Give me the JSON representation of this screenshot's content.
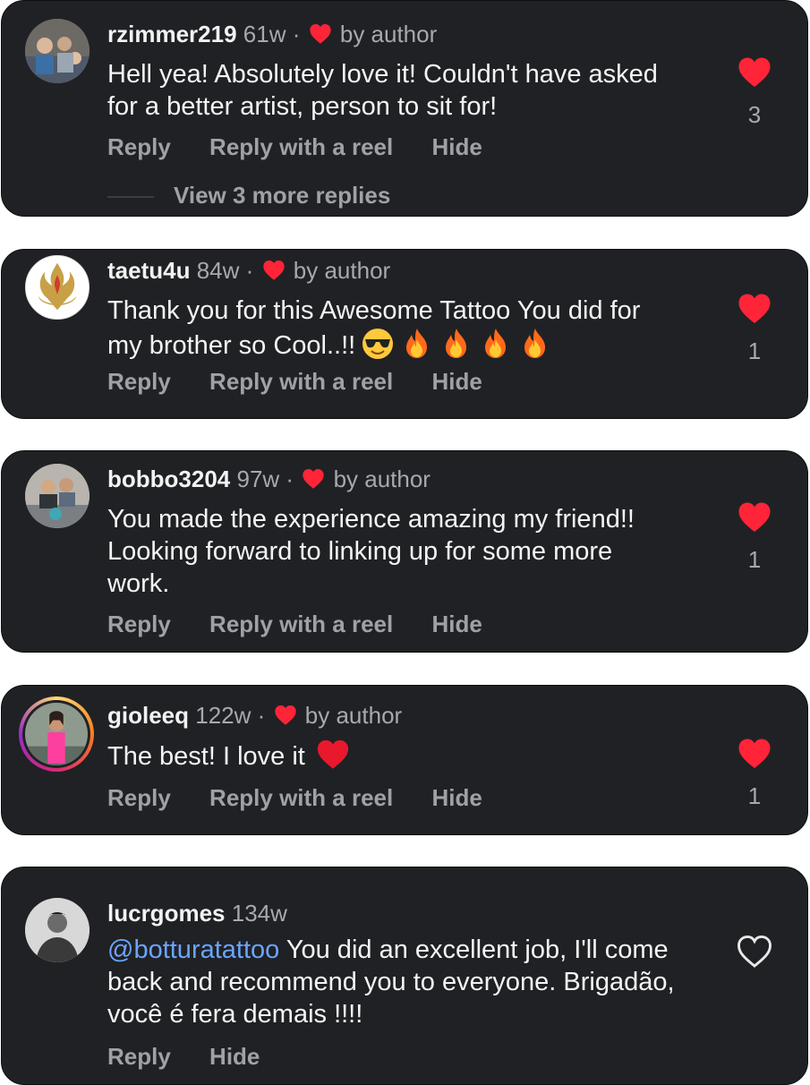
{
  "colors": {
    "card_bg": "#202124",
    "heart_red": "#ff2438",
    "mention_blue": "#6aa5ff",
    "muted_text": "#a8a9ad"
  },
  "comments": [
    {
      "username": "rzimmer219",
      "age": "61w",
      "separator": "·",
      "author_badge": "by author",
      "text": "Hell yea! Absolutely love it! Couldn't have asked for a better artist, person to sit for!",
      "likes": "3",
      "liked": true,
      "actions": {
        "reply": "Reply",
        "reply_reel": "Reply with a reel",
        "hide": "Hide"
      },
      "view_more": "View 3 more replies"
    },
    {
      "username": "taetu4u",
      "age": "84w",
      "separator": "·",
      "author_badge": "by author",
      "text": "Thank you for this Awesome Tattoo You did for my brother so Cool..!!",
      "emojis": [
        "sunglasses-emoji",
        "fire-emoji",
        "fire-emoji",
        "fire-emoji",
        "fire-emoji"
      ],
      "likes": "1",
      "liked": true,
      "actions": {
        "reply": "Reply",
        "reply_reel": "Reply with a reel",
        "hide": "Hide"
      }
    },
    {
      "username": "bobbo3204",
      "age": "97w",
      "separator": "·",
      "author_badge": "by author",
      "text": "You made the experience amazing my friend!! Looking forward to linking up for some more work.",
      "likes": "1",
      "liked": true,
      "actions": {
        "reply": "Reply",
        "reply_reel": "Reply with a reel",
        "hide": "Hide"
      }
    },
    {
      "username": "gioleeq",
      "age": "122w",
      "separator": "·",
      "author_badge": "by author",
      "text": "The best! I love it",
      "emojis": [
        "red-heart-emoji"
      ],
      "likes": "1",
      "liked": true,
      "actions": {
        "reply": "Reply",
        "reply_reel": "Reply with a reel",
        "hide": "Hide"
      }
    },
    {
      "username": "lucrgomes",
      "age": "134w",
      "mention": "@botturatattoo",
      "text": " You did an excellent job, I'll come back and recommend you to everyone. Brigadão, você é fera demais !!!!",
      "liked": false,
      "actions": {
        "reply": "Reply",
        "hide": "Hide"
      }
    }
  ]
}
